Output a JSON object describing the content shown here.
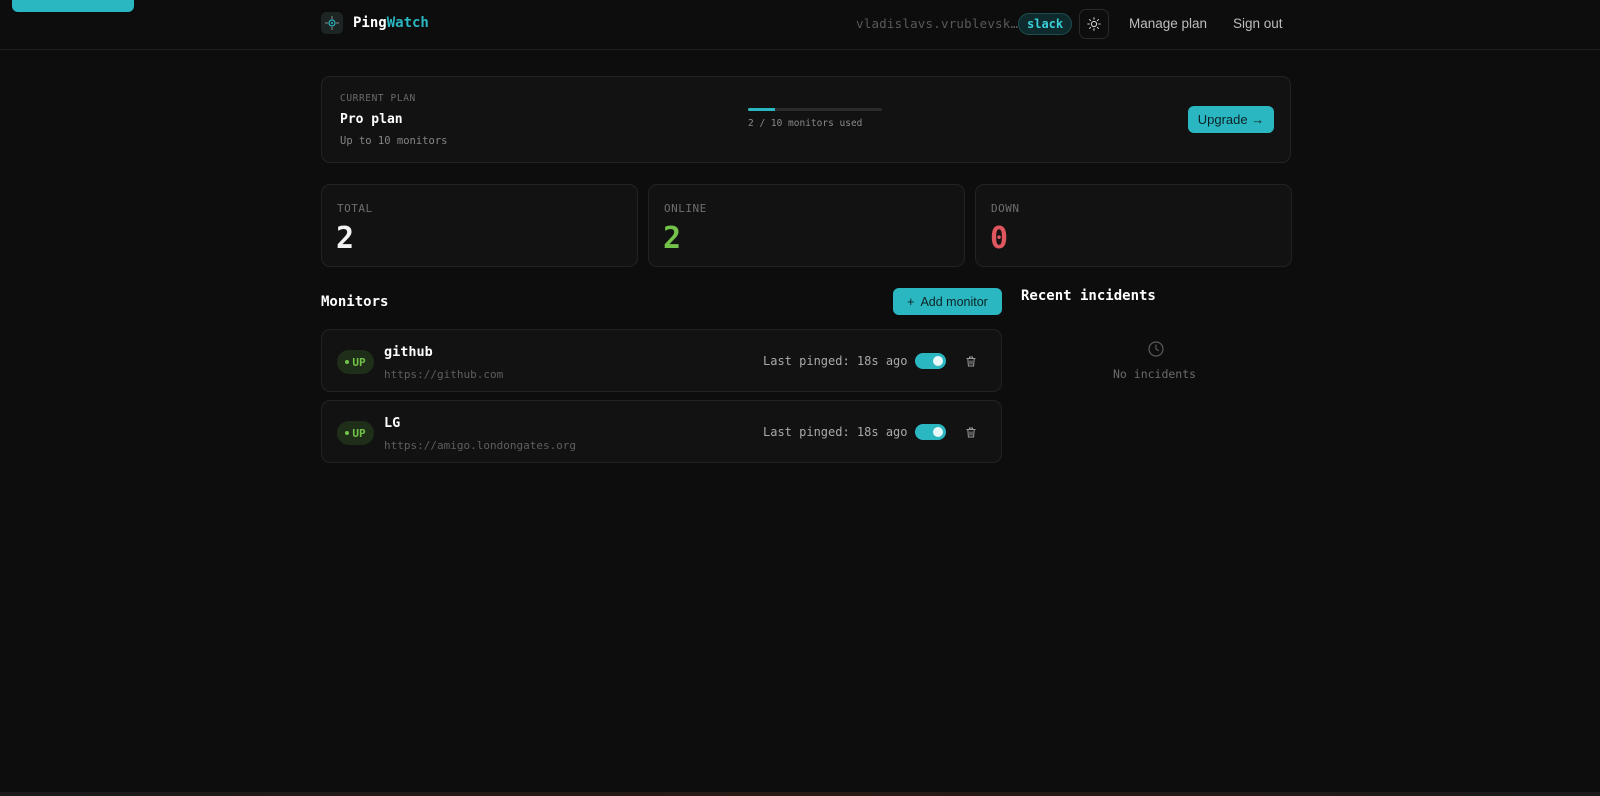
{
  "header": {
    "brand_part1": "Ping",
    "brand_part2": "Watch",
    "user_email": "vladislavs.vrublevsk…",
    "integration_badge": "slack",
    "manage_plan": "Manage plan",
    "sign_out": "Sign out"
  },
  "plan": {
    "kicker": "CURRENT PLAN",
    "name": "Pro plan",
    "limit_text": "Up to 10 monitors",
    "usage_text": "2 / 10 monitors used",
    "usage_fraction": 0.2,
    "upgrade_label": "Upgrade →"
  },
  "stats": [
    {
      "label": "TOTAL",
      "value": "2",
      "color": "#f2f2f2"
    },
    {
      "label": "ONLINE",
      "value": "2",
      "color": "#73c24a"
    },
    {
      "label": "DOWN",
      "value": "0",
      "color": "#e0565f"
    }
  ],
  "monitors_section": {
    "title": "Monitors",
    "add_label": "Add monitor",
    "add_icon": "+"
  },
  "monitors": [
    {
      "status": "UP",
      "name": "github",
      "url": "https://github.com",
      "last_pinged": "Last pinged: 18s ago",
      "enabled": true
    },
    {
      "status": "UP",
      "name": "LG",
      "url": "https://amigo.londongates.org",
      "last_pinged": "Last pinged: 18s ago",
      "enabled": true
    }
  ],
  "incidents": {
    "title": "Recent incidents",
    "empty_text": "No incidents",
    "empty_icon": "clock-icon"
  },
  "colors": {
    "accent": "#2ab7c1",
    "up": "#73c24a",
    "down": "#e0565f",
    "background": "#0d0d0d"
  }
}
